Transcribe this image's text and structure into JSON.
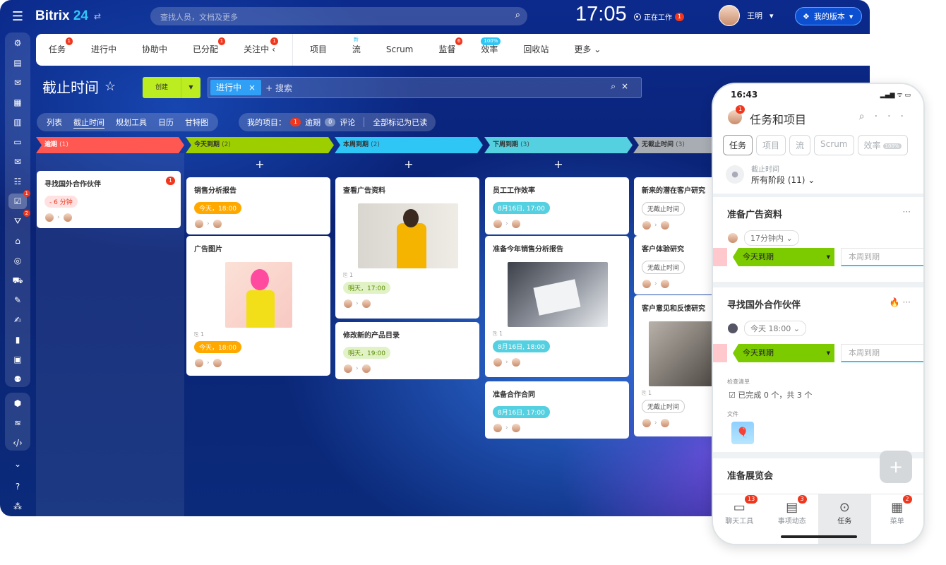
{
  "topbar": {
    "logo": "Bitrix",
    "logo_num": "24",
    "search_placeholder": "查找人员，文档及更多",
    "clock": "17:05",
    "working": "正在工作",
    "working_badge": "1",
    "user_name": "王明",
    "version": "我的版本"
  },
  "sidebar": {
    "badges": {
      "tasks": "1",
      "feed": "2"
    }
  },
  "tabs": [
    {
      "label": "任务",
      "badge": "1"
    },
    {
      "label": "进行中"
    },
    {
      "label": "协助中"
    },
    {
      "label": "已分配",
      "badge": "1"
    },
    {
      "label": "关注中",
      "badge": "1"
    },
    {
      "label": "项目"
    },
    {
      "label": "流",
      "new": "新"
    },
    {
      "label": "Scrum"
    },
    {
      "label": "监督",
      "badge": "6"
    },
    {
      "label": "效率",
      "pct": "100%"
    },
    {
      "label": "回收站"
    },
    {
      "label": "更多"
    }
  ],
  "page": {
    "title": "截止时间",
    "create": "创建",
    "filter_chip": "进行中",
    "search_ph": "+ 搜索"
  },
  "views": [
    "列表",
    "截止时间",
    "规划工具",
    "日历",
    "甘特图"
  ],
  "my": {
    "label": "我的项目：",
    "overdue_count": "1",
    "overdue": "逾期",
    "comments_count": "0",
    "comments": "评论",
    "mark_read": "全部标记为已读"
  },
  "columns": [
    {
      "title": "逾期",
      "count": "(1)",
      "color": "#ff5752",
      "text": "#fff"
    },
    {
      "title": "今天到期",
      "count": "(2)",
      "color": "#9dcf00",
      "text": "#333"
    },
    {
      "title": "本周到期",
      "count": "(2)",
      "color": "#2fc6f6",
      "text": "#333"
    },
    {
      "title": "下周到期",
      "count": "(3)",
      "color": "#55d0e0",
      "text": "#333"
    },
    {
      "title": "无截止时间",
      "count": "(3)",
      "color": "#a8adb4",
      "text": "#333"
    }
  ],
  "cards": {
    "c1": {
      "title": "寻找国外合作伙伴",
      "deadline": "- 6 分钟",
      "badge": "1"
    },
    "c2": {
      "title": "销售分析报告",
      "deadline": "今天，18:00"
    },
    "c3": {
      "title": "广告图片",
      "clip": "1",
      "deadline": "今天，18:00"
    },
    "c4": {
      "title": "查看广告资料",
      "clip": "1",
      "deadline": "明天，17:00"
    },
    "c5": {
      "title": "修改新的产品目录",
      "deadline": "明天，19:00"
    },
    "c6": {
      "title": "员工工作效率",
      "deadline": "8月16日, 17:00"
    },
    "c7": {
      "title": "准备今年销售分析报告",
      "clip": "1",
      "deadline": "8月16日, 18:00"
    },
    "c8": {
      "title": "准备合作合同",
      "deadline": "8月16日, 17:00"
    },
    "c9": {
      "title": "新来的潜在客户研究",
      "deadline": "无截止时间"
    },
    "c10": {
      "title": "客户体验研究",
      "deadline": "无截止时间"
    },
    "c11": {
      "title": "客户意见和反馈研究",
      "clip": "1",
      "deadline": "无截止时间"
    }
  },
  "phone": {
    "time": "16:43",
    "title": "任务和项目",
    "badge": "1",
    "pills": [
      "任务",
      "项目",
      "流",
      "Scrum",
      "效率"
    ],
    "pill_pct": "100%",
    "dl_label": "截止时间",
    "dl_value": "所有阶段 (11)",
    "card1": {
      "title": "准备广告资料",
      "time": "17分钟内",
      "stage": "今天到期",
      "next": "本周到期"
    },
    "card2": {
      "title": "寻找国外合作伙伴",
      "time": "今天 18:00",
      "stage": "今天到期",
      "next": "本周到期",
      "checklist_label": "检查清单",
      "checklist": "已完成 0 个，共 3 个",
      "files_label": "文件"
    },
    "card3": {
      "title": "准备展览会"
    },
    "tabbar": [
      {
        "label": "聊天工具",
        "badge": "13"
      },
      {
        "label": "事项动态",
        "badge": "3"
      },
      {
        "label": "任务"
      },
      {
        "label": "菜单",
        "badge": "2"
      }
    ]
  }
}
